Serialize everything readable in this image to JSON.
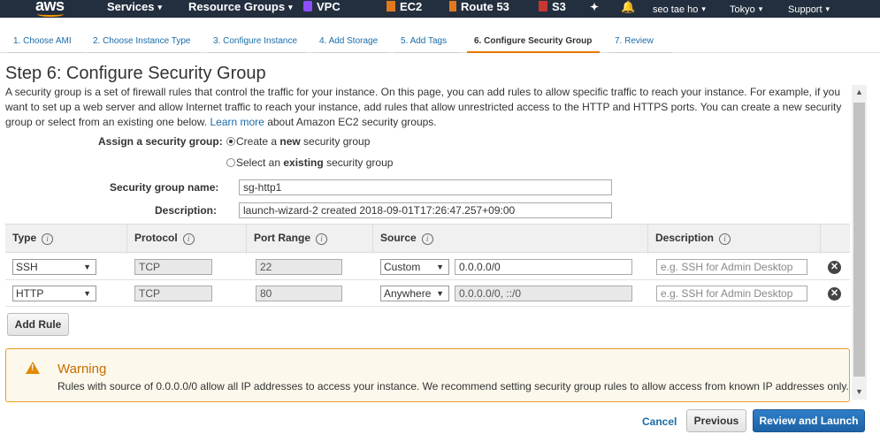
{
  "topnav": {
    "logo": "aws",
    "services": "Services",
    "resource_groups": "Resource Groups",
    "vpc": "VPC",
    "ec2": "EC2",
    "route53": "Route 53",
    "s3": "S3",
    "user": "seo tae ho",
    "region": "Tokyo",
    "support": "Support",
    "colors": {
      "bar": "#232f3e",
      "logo_smile": "#ff9900"
    }
  },
  "steps": [
    {
      "label": "1. Choose AMI"
    },
    {
      "label": "2. Choose Instance Type"
    },
    {
      "label": "3. Configure Instance"
    },
    {
      "label": "4. Add Storage"
    },
    {
      "label": "5. Add Tags"
    },
    {
      "label": "6. Configure Security Group",
      "active": true
    },
    {
      "label": "7. Review"
    }
  ],
  "page": {
    "title": "Step 6: Configure Security Group",
    "intro_text": "A security group is a set of firewall rules that control the traffic for your instance. On this page, you can add rules to allow specific traffic to reach your instance. For example, if you want to set up a web server and allow Internet traffic to reach your instance, add rules that allow unrestricted access to the HTTP and HTTPS ports. You can create a new security group or select from an existing one below.",
    "learn_more": "Learn more",
    "intro_suffix": "about Amazon EC2 security groups."
  },
  "assign": {
    "label": "Assign a security group:",
    "option_new_prefix": "Create a ",
    "option_new_bold": "new",
    "option_new_suffix": " security group",
    "option_existing_prefix": "Select an ",
    "option_existing_bold": "existing",
    "option_existing_suffix": " security group",
    "selected": "new"
  },
  "group": {
    "name_label": "Security group name:",
    "name_value": "sg-http1",
    "description_label": "Description:",
    "description_value": "launch-wizard-2 created 2018-09-01T17:26:47.257+09:00"
  },
  "table": {
    "headers": {
      "type": "Type",
      "protocol": "Protocol",
      "port_range": "Port Range",
      "source": "Source",
      "description": "Description"
    },
    "rows": [
      {
        "type": "SSH",
        "protocol": "TCP",
        "port_range": "22",
        "source_mode": "Custom",
        "source_value": "0.0.0.0/0",
        "description_placeholder": "e.g. SSH for Admin Desktop"
      },
      {
        "type": "HTTP",
        "protocol": "TCP",
        "port_range": "80",
        "source_mode": "Anywhere",
        "source_value": "0.0.0.0/0, ::/0",
        "description_placeholder": "e.g. SSH for Admin Desktop"
      }
    ],
    "add_rule": "Add Rule"
  },
  "warning": {
    "title": "Warning",
    "text": "Rules with source of 0.0.0.0/0 allow all IP addresses to access your instance. We recommend setting security group rules to allow access from known IP addresses only.",
    "colors": {
      "border": "#e6a020",
      "title": "#c76d00",
      "icon": "#e08a00"
    }
  },
  "footer": {
    "cancel": "Cancel",
    "previous": "Previous",
    "review_and_launch": "Review and Launch"
  }
}
